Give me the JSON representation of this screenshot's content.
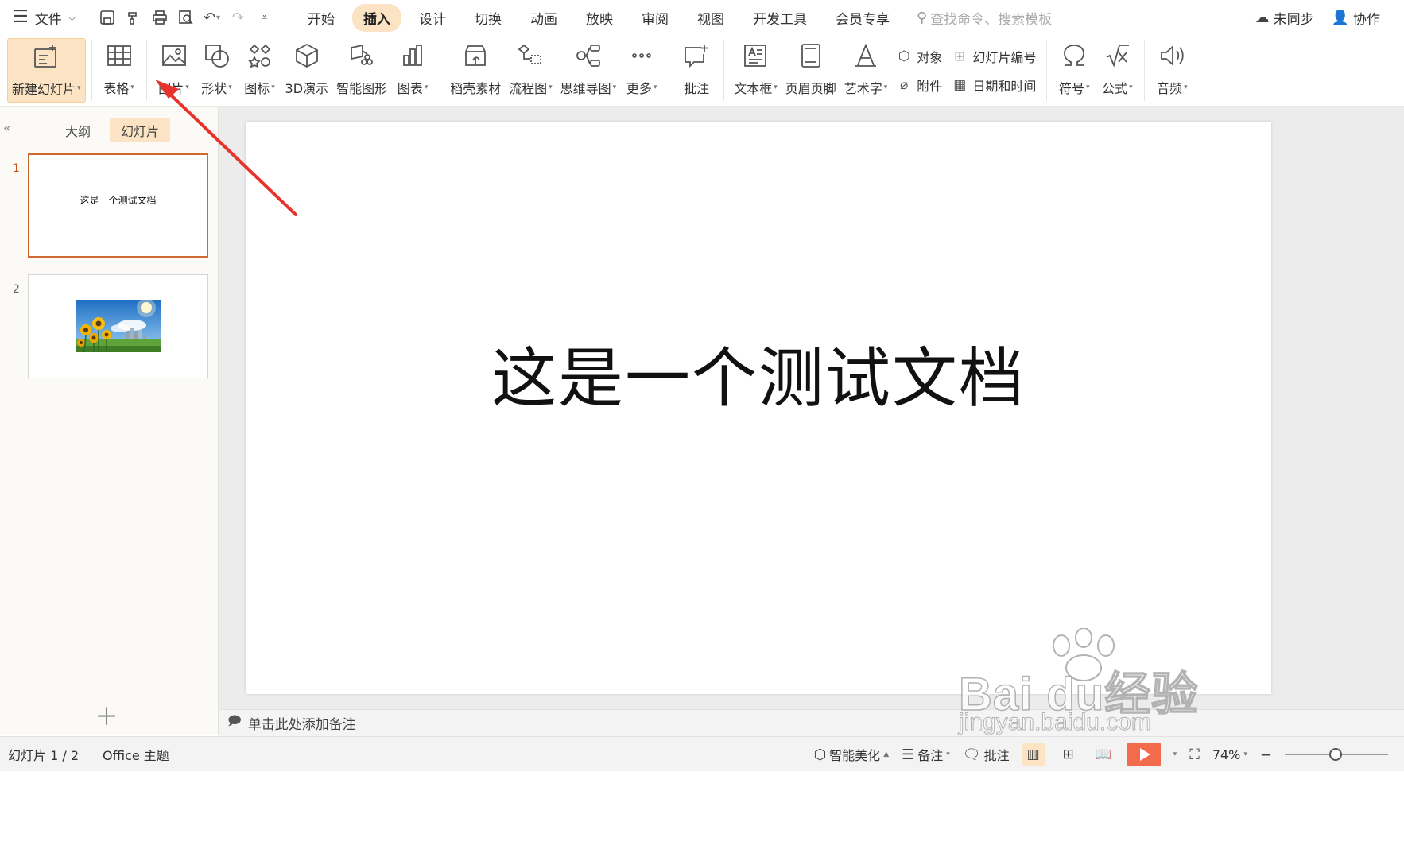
{
  "menubar": {
    "file_label": "文件",
    "tabs": [
      {
        "label": "开始"
      },
      {
        "label": "插入"
      },
      {
        "label": "设计"
      },
      {
        "label": "切换"
      },
      {
        "label": "动画"
      },
      {
        "label": "放映"
      },
      {
        "label": "审阅"
      },
      {
        "label": "视图"
      },
      {
        "label": "开发工具"
      },
      {
        "label": "会员专享"
      }
    ],
    "active_tab": "插入",
    "search_placeholder": "查找命令、搜索模板",
    "sync_label": "未同步",
    "collab_label": "协作"
  },
  "ribbon": {
    "new_slide": "新建幻灯片",
    "table": "表格",
    "picture": "图片",
    "shape": "形状",
    "icons": "图标",
    "demo3d": "3D演示",
    "smartart": "智能图形",
    "chart": "图表",
    "docer": "稻壳素材",
    "flowchart": "流程图",
    "mindmap": "思维导图",
    "more": "更多",
    "comment": "批注",
    "textbox": "文本框",
    "header_footer": "页眉页脚",
    "wordart": "艺术字",
    "object": "对象",
    "attachment": "附件",
    "slide_number": "幻灯片编号",
    "datetime": "日期和时间",
    "symbol": "符号",
    "formula": "公式",
    "audio": "音频"
  },
  "left_panel": {
    "view_tabs": [
      {
        "label": "大纲"
      },
      {
        "label": "幻灯片"
      }
    ],
    "active_view": "幻灯片",
    "slides": [
      {
        "number": "1",
        "text": "这是一个测试文档"
      },
      {
        "number": "2",
        "text": ""
      }
    ]
  },
  "slide": {
    "title": "这是一个测试文档"
  },
  "notes_placeholder": "单击此处添加备注",
  "statusbar": {
    "slide_indicator": "幻灯片 1 / 2",
    "theme": "Office 主题",
    "beautify": "智能美化",
    "notes": "备注",
    "comments": "批注",
    "zoom": "74%"
  },
  "watermark": {
    "logo_text": "Bai du经验",
    "url": "jingyan.baidu.com"
  },
  "colors": {
    "accent": "#fbe3c3",
    "selection_border": "#d2692c",
    "play_button": "#f26b4d",
    "annotation_arrow": "#e8322c"
  }
}
